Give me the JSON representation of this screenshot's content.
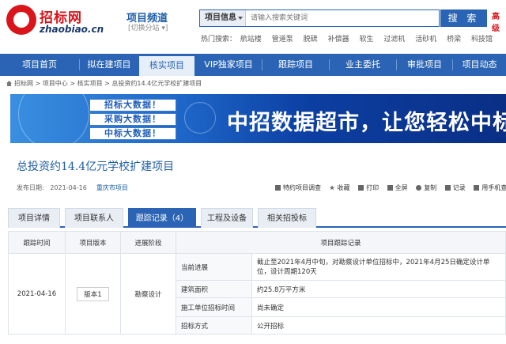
{
  "logo": {
    "cn": "招标网",
    "en": "zhaobiao.cn"
  },
  "channel": {
    "title": "项目频道",
    "sub": "[切换分站 ▾]"
  },
  "search": {
    "category": "项目信息",
    "placeholder": "请输入搜索关键词",
    "button": "搜 索"
  },
  "tel": "高级",
  "hot": {
    "label": "热门搜索：",
    "items": [
      "航站楼",
      "管道泵",
      "脱硫",
      "补偿器",
      "软生",
      "过滤机",
      "活砂机",
      "桥梁",
      "科技馆"
    ]
  },
  "nav": [
    "项目首页",
    "拟在建项目",
    "核实项目",
    "VIP独家项目",
    "跟踪项目",
    "业主委托",
    "审批项目",
    "项目动态"
  ],
  "breadcrumb": [
    "招标网",
    "项目中心",
    "核实项目",
    "总投资约14.4亿元学校扩建项目"
  ],
  "banner": {
    "buttons": [
      "招标大数据！",
      "采购大数据！",
      "中标大数据！"
    ],
    "headline": "中招数据超市，让您轻松中标"
  },
  "project": {
    "title": "总投资约14.4亿元学校扩建项目",
    "date_label": "发布日期:",
    "date": "2021-04-16",
    "location": "重庆市项目"
  },
  "tools": [
    "特约项目调查",
    "收藏",
    "打印",
    "全屏",
    "复制",
    "记录",
    "用手机查看"
  ],
  "tabs": [
    "项目详情",
    "项目联系人",
    "跟踪记录（4）",
    "工程及设备",
    "相关招投标"
  ],
  "table": {
    "headers": [
      "跟踪时间",
      "项目版本",
      "进展阶段",
      "项目跟踪记录"
    ],
    "date": "2021-04-16",
    "version": "版本1",
    "stage": "勘察设计",
    "rows": [
      {
        "label": "当前进展",
        "value": "截止至2021年4月中旬，对勘察设计单位招标中，2021年4月25日确定设计单位，设计周期120天"
      },
      {
        "label": "建筑面积",
        "value": "约25.8万平方米"
      },
      {
        "label": "施工单位招标时间",
        "value": "尚未确定"
      },
      {
        "label": "招标方式",
        "value": "公开招标"
      }
    ]
  }
}
